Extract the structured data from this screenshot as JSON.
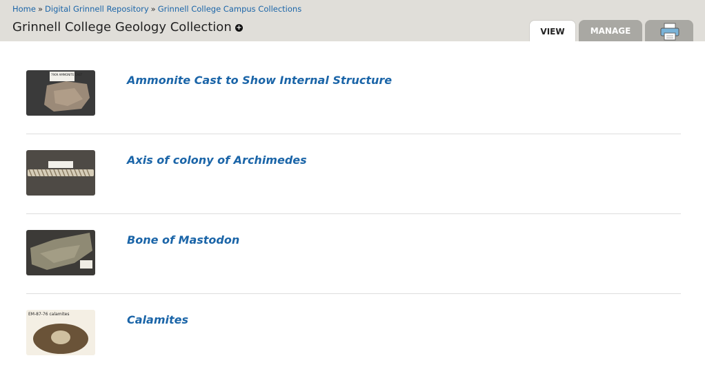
{
  "breadcrumb": {
    "items": [
      "Home",
      "Digital Grinnell Repository",
      "Grinnell College Campus Collections"
    ],
    "separator": "»"
  },
  "page": {
    "title": "Grinnell College Geology Collection"
  },
  "tabs": {
    "view": "VIEW",
    "manage": "MANAGE"
  },
  "icons": {
    "add": "plus-circle-icon",
    "print": "printer-icon"
  },
  "items": [
    {
      "title": "Ammonite Cast to Show Internal Structure",
      "thumb_label": "7909 AMMONITE CAST"
    },
    {
      "title": "Axis of colony of Archimedes",
      "thumb_label": ""
    },
    {
      "title": "Bone of Mastodon",
      "thumb_label": ""
    },
    {
      "title": "Calamites",
      "thumb_label": "EM-87-76 calamites"
    }
  ],
  "colors": {
    "header_bg": "#e0ded9",
    "link": "#1b65a8",
    "tab_inactive": "#a9a8a3"
  }
}
